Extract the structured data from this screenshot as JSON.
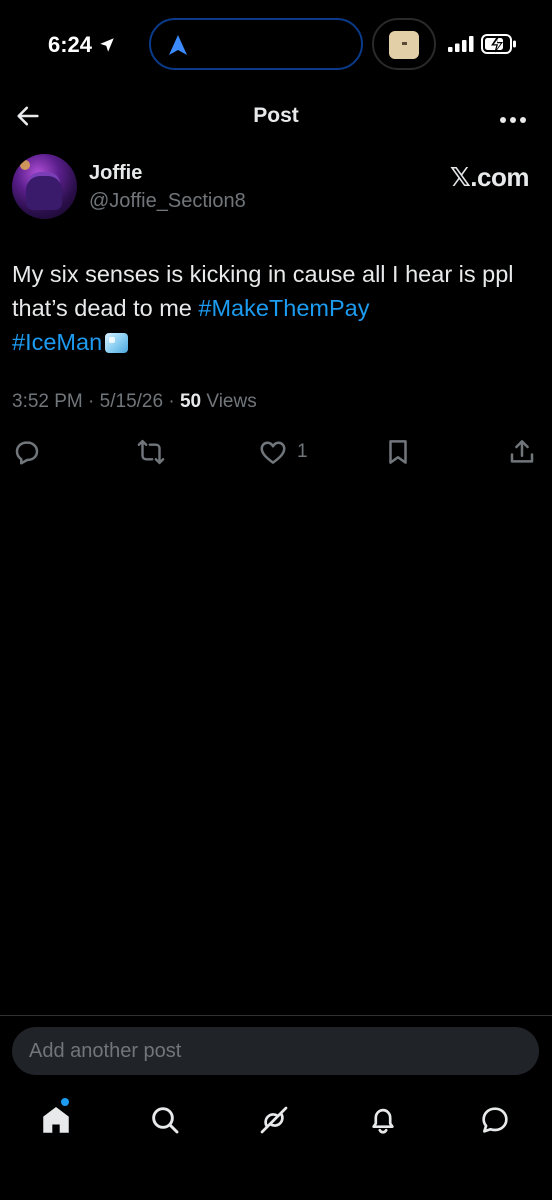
{
  "status_bar": {
    "time": "6:24"
  },
  "header": {
    "title": "Post"
  },
  "author": {
    "display_name": "Joffie",
    "handle": "@Joffie_Section8"
  },
  "watermark": "𝕏.com",
  "post": {
    "text_line": "My six senses is kicking in cause all I hear is ppl that’s dead to me ",
    "hashtag_1": "#MakeThemPay",
    "hashtag_2": "#IceMan",
    "emoji": "ice-cube",
    "time": "3:52 PM",
    "date": "5/15/26",
    "views_count": "50",
    "views_label": "Views",
    "separator": " · "
  },
  "actions": {
    "like_count": "1"
  },
  "reply": {
    "placeholder": "Add another post"
  },
  "icons": {
    "back": "back-arrow-icon",
    "more": "more-horizontal-icon",
    "reply": "reply-icon",
    "repost": "repost-icon",
    "like": "heart-icon",
    "bookmark": "bookmark-icon",
    "share": "share-icon",
    "home": "home-icon",
    "search": "search-icon",
    "grok": "grok-icon",
    "notifications": "bell-icon",
    "messages": "messages-icon"
  },
  "colors": {
    "background": "#000000",
    "accent": "#1d9bf0",
    "text": "#e7e9ea",
    "muted": "#71767b"
  }
}
